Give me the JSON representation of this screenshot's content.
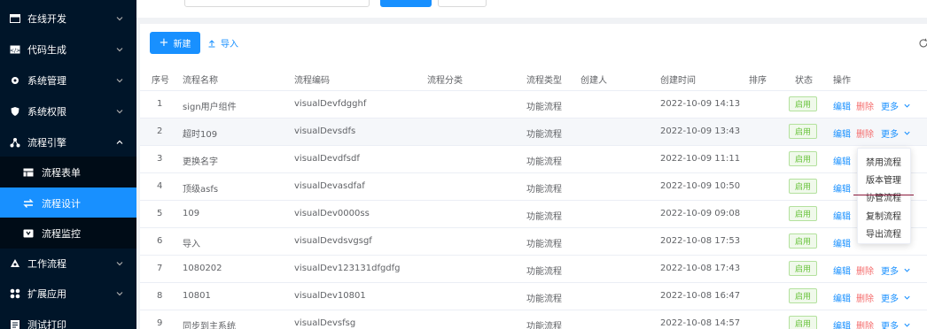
{
  "sidebar": {
    "items": [
      {
        "label": "在线开发",
        "icon": "window-icon"
      },
      {
        "label": "代码生成",
        "icon": "code-icon"
      },
      {
        "label": "系统管理",
        "icon": "gear-icon"
      },
      {
        "label": "系统权限",
        "icon": "shield-icon"
      },
      {
        "label": "流程引擎",
        "icon": "flow-icon"
      },
      {
        "label": "工作流程",
        "icon": "workflow-icon"
      },
      {
        "label": "扩展应用",
        "icon": "extend-icon"
      },
      {
        "label": "测试打印",
        "icon": "print-icon"
      }
    ],
    "sub_items": [
      {
        "label": "流程表单",
        "icon": "table-icon"
      },
      {
        "label": "流程设计",
        "icon": "swap-icon"
      },
      {
        "label": "流程监控",
        "icon": "monitor-icon"
      }
    ]
  },
  "toolbar": {
    "new_label": "新建",
    "import_label": "导入"
  },
  "table": {
    "headers": [
      "序号",
      "流程名称",
      "流程编码",
      "流程分类",
      "流程类型",
      "创建人",
      "创建时间",
      "排序",
      "状态",
      "操作"
    ],
    "rows": [
      {
        "no": "1",
        "name": "sign用户组件",
        "code": "visualDevfdgghf",
        "type": "功能流程",
        "time": "2022-10-09 14:13",
        "status": "启用"
      },
      {
        "no": "2",
        "name": "超时109",
        "code": "visualDevsdfs",
        "type": "功能流程",
        "time": "2022-10-09 13:43",
        "status": "启用"
      },
      {
        "no": "3",
        "name": "更换名字",
        "code": "visualDevdfsdf",
        "type": "功能流程",
        "time": "2022-10-09 11:11",
        "status": "启用"
      },
      {
        "no": "4",
        "name": "顶级asfs",
        "code": "visualDevasdfaf",
        "type": "功能流程",
        "time": "2022-10-09 10:50",
        "status": "启用"
      },
      {
        "no": "5",
        "name": "109",
        "code": "visualDev0000ss",
        "type": "功能流程",
        "time": "2022-10-09 09:08",
        "status": "启用"
      },
      {
        "no": "6",
        "name": "导入",
        "code": "visualDevdsvgsgf",
        "type": "功能流程",
        "time": "2022-10-08 17:53",
        "status": "启用"
      },
      {
        "no": "7",
        "name": "1080202",
        "code": "visualDev123131dfgdfg",
        "type": "功能流程",
        "time": "2022-10-08 17:43",
        "status": "启用"
      },
      {
        "no": "8",
        "name": "10801",
        "code": "visualDev10801",
        "type": "功能流程",
        "time": "2022-10-08 16:47",
        "status": "启用"
      },
      {
        "no": "9",
        "name": "同步到主系统",
        "code": "visualDevsfsg",
        "type": "功能流程",
        "time": "2022-10-08 14:57",
        "status": "启用"
      }
    ],
    "actions": {
      "edit": "编辑",
      "delete": "删除",
      "more": "更多"
    }
  },
  "dropdown": {
    "items": [
      "禁用流程",
      "版本管理",
      "协管流程",
      "复制流程",
      "导出流程"
    ]
  },
  "colors": {
    "accent": "#1890ff",
    "sidebar": "#001529",
    "danger": "#f56c6c",
    "success": "#67c23a"
  }
}
